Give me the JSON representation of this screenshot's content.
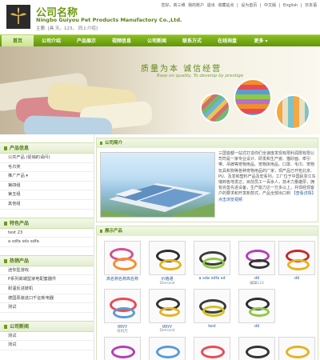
{
  "header": {
    "brand_name": "公司名称",
    "brand_en": "Ningbo Guiyou Pet Products Manufactory Co.,Ltd.",
    "phone_line": "主要: [具 天。123。 同上介绍]",
    "top_links": [
      "您好，商三维",
      "我的账户",
      "退出",
      "收藏站点",
      "|",
      "设为首页",
      "|",
      "中文版",
      "|",
      "English",
      "|",
      "日本语"
    ]
  },
  "nav": {
    "items": [
      {
        "label": "首页",
        "active": true
      },
      {
        "label": "公司介绍",
        "active": false
      },
      {
        "label": "产品展示",
        "active": false
      },
      {
        "label": "视频信息",
        "active": false
      },
      {
        "label": "公司新闻",
        "active": false
      },
      {
        "label": "联系方式",
        "active": false
      },
      {
        "label": "在线询盘",
        "active": false
      },
      {
        "label": "更多 ▾",
        "active": false
      }
    ]
  },
  "banner": {
    "slogan": "质量为本  诚信经营",
    "subtitle": "Base on quality, To develop by prestige"
  },
  "sidebar": {
    "sections": [
      {
        "title": "产品信息",
        "items": [
          "公共产品 (促销的请问)",
          "毛巾类",
          "推广产品 ▾",
          "第四组",
          "第五组",
          "其他组"
        ]
      },
      {
        "title": "特色产品",
        "items": [
          "test 23",
          "a sdfa sds sdfa"
        ]
      },
      {
        "title": "热销产品",
        "items": [
          "迷你型游戏",
          "P系列高端型家电配套器件",
          "耐温反进玻机",
          "德国原装进口千征新电器",
          "测试"
        ]
      },
      {
        "title": "公司新闻",
        "items": [
          "测试",
          "测试"
        ]
      }
    ]
  },
  "intro": {
    "title": "公司简介",
    "text": "三国首都一站式打造你们全速度发现有限利润限有限公司司是一家专业设计、研发和生产瓷、猫砂面、牵引带、吊牌等宠物用品、宠物床用品、口罩、毛巾、宠物玩具和狗等各种宠物用品的厂家，现产品已开拓北京、PU、及发和塑料产品及宏系列，工厂位于中国民浙江东瑞到各地发达，目前员工一百余人，技术力量雄厚，拥有完善先进设备，生产能力达一万多以上，并现经现客户的要求和开发新款式，产品全部出口到",
    "more1": "【查看详情】",
    "more2": "点击浏览视频"
  },
  "products": {
    "title": "展示产品",
    "items": [
      {
        "name": "高名称名称高名称",
        "sub": ""
      },
      {
        "name": "价格通",
        "sub": "Demand"
      },
      {
        "name": "a sda sdfa sd",
        "sub": ""
      },
      {
        "name": "dd",
        "sub": "编辑123"
      },
      {
        "name": "dd",
        "sub": ""
      },
      {
        "name": "ggyy",
        "sub": "有机元"
      },
      {
        "name": "ggyy",
        "sub": "Demand"
      },
      {
        "name": "test",
        "sub": ""
      },
      {
        "name": "dd",
        "sub": ""
      },
      {
        "name": "",
        "sub": ""
      },
      {
        "name": "",
        "sub": ""
      },
      {
        "name": "",
        "sub": ""
      },
      {
        "name": "",
        "sub": ""
      },
      {
        "name": "",
        "sub": ""
      },
      {
        "name": "",
        "sub": ""
      }
    ]
  },
  "colors": {
    "brand_green": "#6d9c11",
    "nav_green": "#5f950b",
    "link_blue": "#2a5b9e"
  }
}
